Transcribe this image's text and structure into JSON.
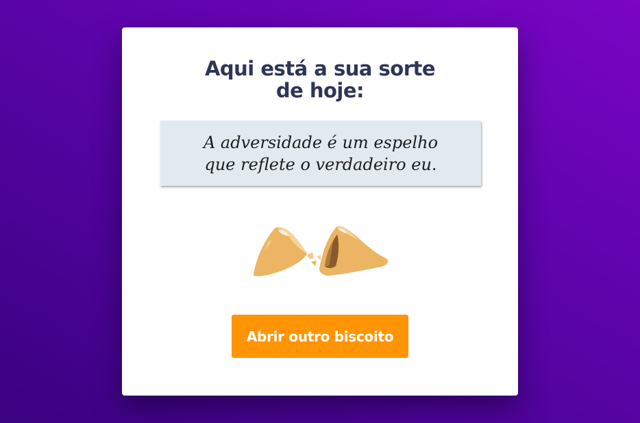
{
  "card": {
    "title_line1": "Aqui está a sua sorte",
    "title_line2": "de hoje:",
    "fortune_text": "A adversidade é um espelho que reflete o verdadeiro eu.",
    "button_label": "Abrir outro biscoito",
    "cookie_icon": "broken-fortune-cookie-icon"
  },
  "colors": {
    "background_start": "#3a0280",
    "background_end": "#7a05c4",
    "card": "#ffffff",
    "title": "#2f3556",
    "fortune_bg": "#e2eaf0",
    "button": "#ff9505",
    "button_text": "#ffffff"
  }
}
